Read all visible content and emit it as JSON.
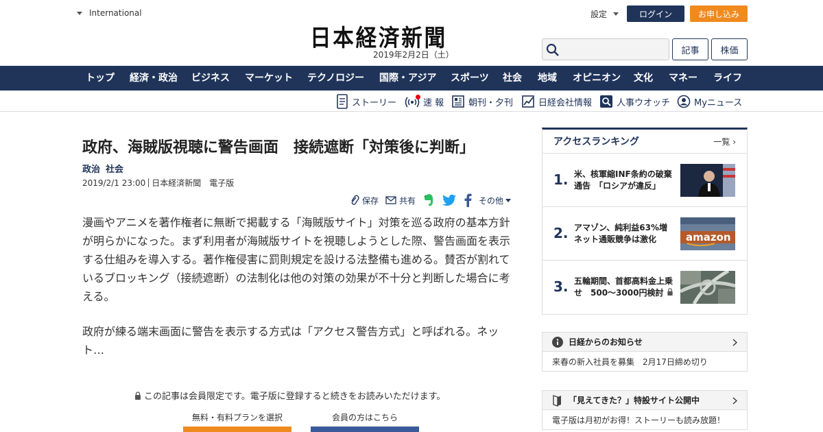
{
  "header": {
    "edition": "International",
    "logo": "日本経済新聞",
    "date": "2019年2月2日（土）",
    "settings": "設定",
    "login": "ログイン",
    "apply": "お申し込み",
    "search_placeholder": "",
    "articles_btn": "記事",
    "stocks_btn": "株価"
  },
  "nav": {
    "items": [
      "トップ",
      "経済・政治",
      "ビジネス",
      "マーケット",
      "テクノロジー",
      "国際・アジア",
      "スポーツ",
      "社会",
      "地域",
      "オピニオン",
      "文化",
      "マネー",
      "ライフ"
    ]
  },
  "subnav": {
    "items": [
      "ストーリー",
      "速 報",
      "朝刊・夕刊",
      "日経会社情報",
      "人事ウオッチ",
      "Myニュース"
    ]
  },
  "article": {
    "headline": "政府、海賊版視聴に警告画面　接続遮断「対策後に判断」",
    "categories": [
      "政治",
      "社会"
    ],
    "datetime": "2019/2/1 23:00",
    "source": "日本経済新聞　電子版",
    "share": {
      "save": "保存",
      "share": "共有",
      "other": "その他"
    },
    "paragraphs": [
      "漫画やアニメを著作権者に無断で掲載する「海賊版サイト」対策を巡る政府の基本方針が明らかになった。まず利用者が海賊版サイトを視聴しようとした際、警告画面を表示する仕組みを導入する。著作権侵害に罰則規定を設ける法整備も進める。賛否が割れているブロッキング（接続遮断）の法制化は他の対策の効果が不十分と判断した場合に考える。",
      "政府が練る端末画面に警告を表示する方式は「アクセス警告方式」と呼ばれる。ネット…"
    ],
    "members_note": "この記事は会員限定です。電子版に登録すると続きをお読みいただけます。",
    "plan_label": "無料・有料プランを選択",
    "member_label": "会員の方はこちら"
  },
  "ranking": {
    "title": "アクセスランキング",
    "more": "一覧",
    "items": [
      {
        "rank": "1.",
        "text": "米、核軍縮INF条約の破棄通告　「ロシアが違反」"
      },
      {
        "rank": "2.",
        "text": "アマゾン、純利益63%増 ネット通販競争は激化"
      },
      {
        "rank": "3.",
        "text": "五輪期間、首都高料金上乗せ　500～3000円検討"
      }
    ]
  },
  "notice": {
    "title": "日経からのお知らせ",
    "body": "来春の新入社員を募集　2月17日締め切り"
  },
  "promo": {
    "title": "「見えてきた？」特設サイト公開中",
    "body": "電子版は月初がお得！ストーリーも読み放題！"
  },
  "colors": {
    "navy": "#20345a",
    "orange": "#f08a1f",
    "member_blue": "#3b5a9a",
    "alert_red": "#e60012"
  }
}
